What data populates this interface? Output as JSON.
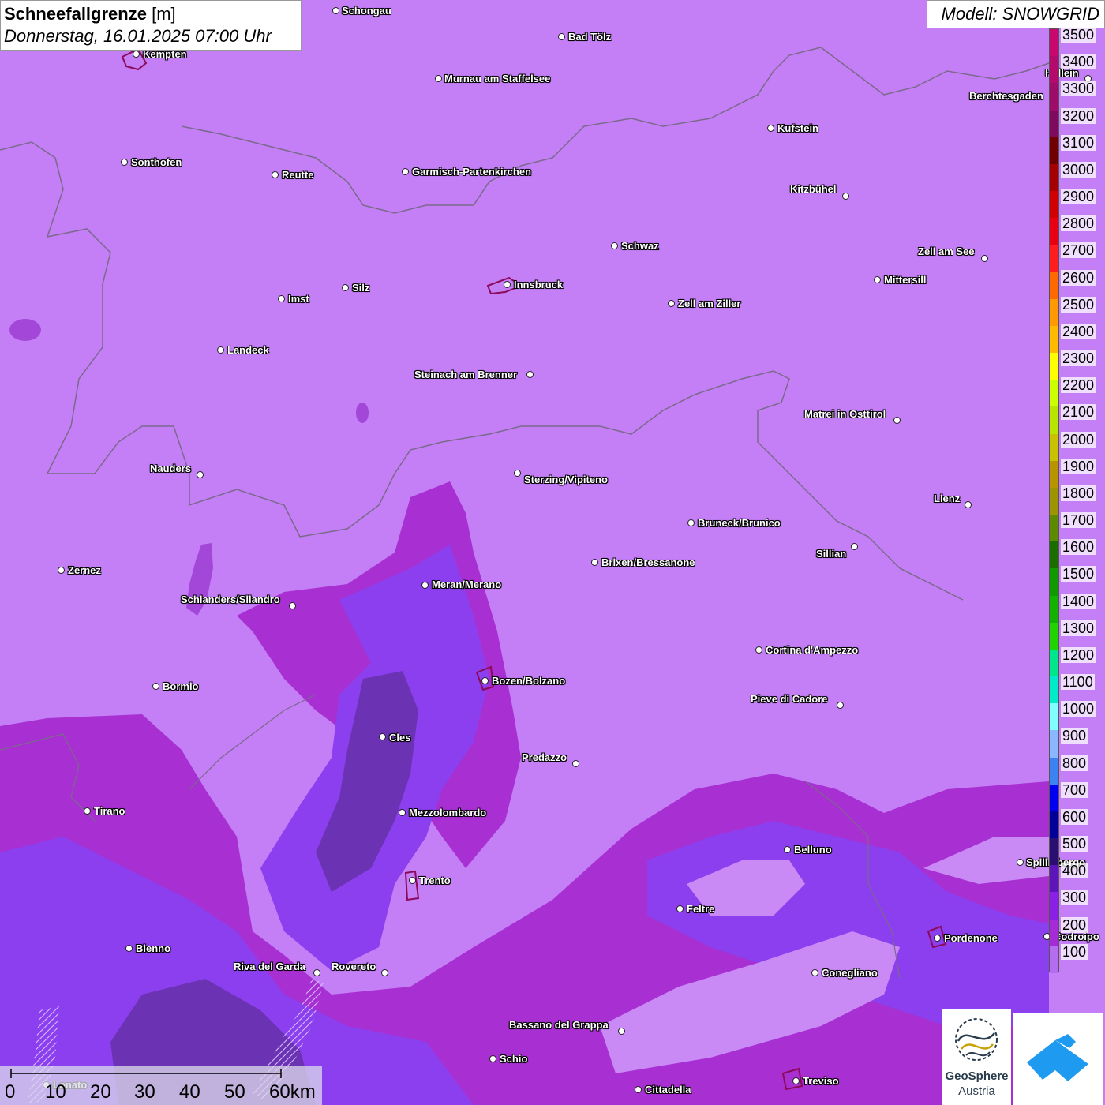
{
  "title": {
    "parameter": "Schneefallgrenze",
    "unit": "[m]",
    "datetime": "Donnerstag, 16.01.2025 07:00 Uhr"
  },
  "model": "Modell: SNOWGRID",
  "legend": {
    "labels": [
      "3500",
      "3400",
      "3300",
      "3200",
      "3100",
      "3000",
      "2900",
      "2800",
      "2700",
      "2600",
      "2500",
      "2400",
      "2300",
      "2200",
      "2100",
      "2000",
      "1900",
      "1800",
      "1700",
      "1600",
      "1500",
      "1400",
      "1300",
      "1200",
      "1100",
      "1000",
      "900",
      "800",
      "700",
      "600",
      "500",
      "400",
      "300",
      "200",
      "100"
    ],
    "colors": [
      "#c8086f",
      "#b30a6b",
      "#9d0c68",
      "#7f0a5d",
      "#6e0000",
      "#a50000",
      "#d10000",
      "#e80012",
      "#ff1d1d",
      "#ff6a00",
      "#ff9a00",
      "#ffbb00",
      "#ffff00",
      "#ccff00",
      "#b8e600",
      "#c9c200",
      "#b89400",
      "#9c9400",
      "#5d8a00",
      "#1a6e00",
      "#109a00",
      "#12b300",
      "#1fd400",
      "#00e68a",
      "#00ebc8",
      "#80ffff",
      "#8ab8ff",
      "#3b83f0",
      "#0000ee",
      "#000099",
      "#2b0f70",
      "#5d14b8",
      "#8a1fe6",
      "#a42bd6",
      "#b56df0"
    ]
  },
  "cities": [
    {
      "name": "Schongau"
    },
    {
      "name": "Bad Tölz"
    },
    {
      "name": "Kempten"
    },
    {
      "name": "Murnau am Staffelsee"
    },
    {
      "name": "Hallein"
    },
    {
      "name": "Berchtesgaden"
    },
    {
      "name": "Kufstein"
    },
    {
      "name": "Sonthofen"
    },
    {
      "name": "Reutte"
    },
    {
      "name": "Garmisch-Partenkirchen"
    },
    {
      "name": "Kitzbühel"
    },
    {
      "name": "Schwaz"
    },
    {
      "name": "Zell am See"
    },
    {
      "name": "Innsbruck"
    },
    {
      "name": "Mittersill"
    },
    {
      "name": "Imst"
    },
    {
      "name": "Silz"
    },
    {
      "name": "Zell am Ziller"
    },
    {
      "name": "Landeck"
    },
    {
      "name": "Steinach am Brenner"
    },
    {
      "name": "Matrei in Osttirol"
    },
    {
      "name": "Nauders"
    },
    {
      "name": "Sterzing/Vipiteno"
    },
    {
      "name": "Lienz"
    },
    {
      "name": "Bruneck/Brunico"
    },
    {
      "name": "Sillian"
    },
    {
      "name": "Brixen/Bressanone"
    },
    {
      "name": "Zernez"
    },
    {
      "name": "Meran/Merano"
    },
    {
      "name": "Schlanders/Silandro"
    },
    {
      "name": "Cortina d'Ampezzo"
    },
    {
      "name": "Bozen/Bolzano"
    },
    {
      "name": "Bormio"
    },
    {
      "name": "Pieve di Cadore"
    },
    {
      "name": "Cles"
    },
    {
      "name": "Predazzo"
    },
    {
      "name": "Tirano"
    },
    {
      "name": "Mezzolombardo"
    },
    {
      "name": "Belluno"
    },
    {
      "name": "Spilimbergo"
    },
    {
      "name": "Trento"
    },
    {
      "name": "Feltre"
    },
    {
      "name": "Bienno"
    },
    {
      "name": "Pordenone"
    },
    {
      "name": "Riva del Garda"
    },
    {
      "name": "Rovereto"
    },
    {
      "name": "Conegliano"
    },
    {
      "name": "Bassano del Grappa"
    },
    {
      "name": "Schio"
    },
    {
      "name": "Treviso"
    },
    {
      "name": "Cittadella"
    },
    {
      "name": "Lonato"
    },
    {
      "name": "Codroipo"
    }
  ],
  "scale_bar": {
    "labels": [
      "0",
      "10",
      "20",
      "30",
      "40",
      "50",
      "60km"
    ]
  },
  "logos": {
    "geosphere_line1": "GeoSphere",
    "geosphere_line2": "Austria"
  }
}
